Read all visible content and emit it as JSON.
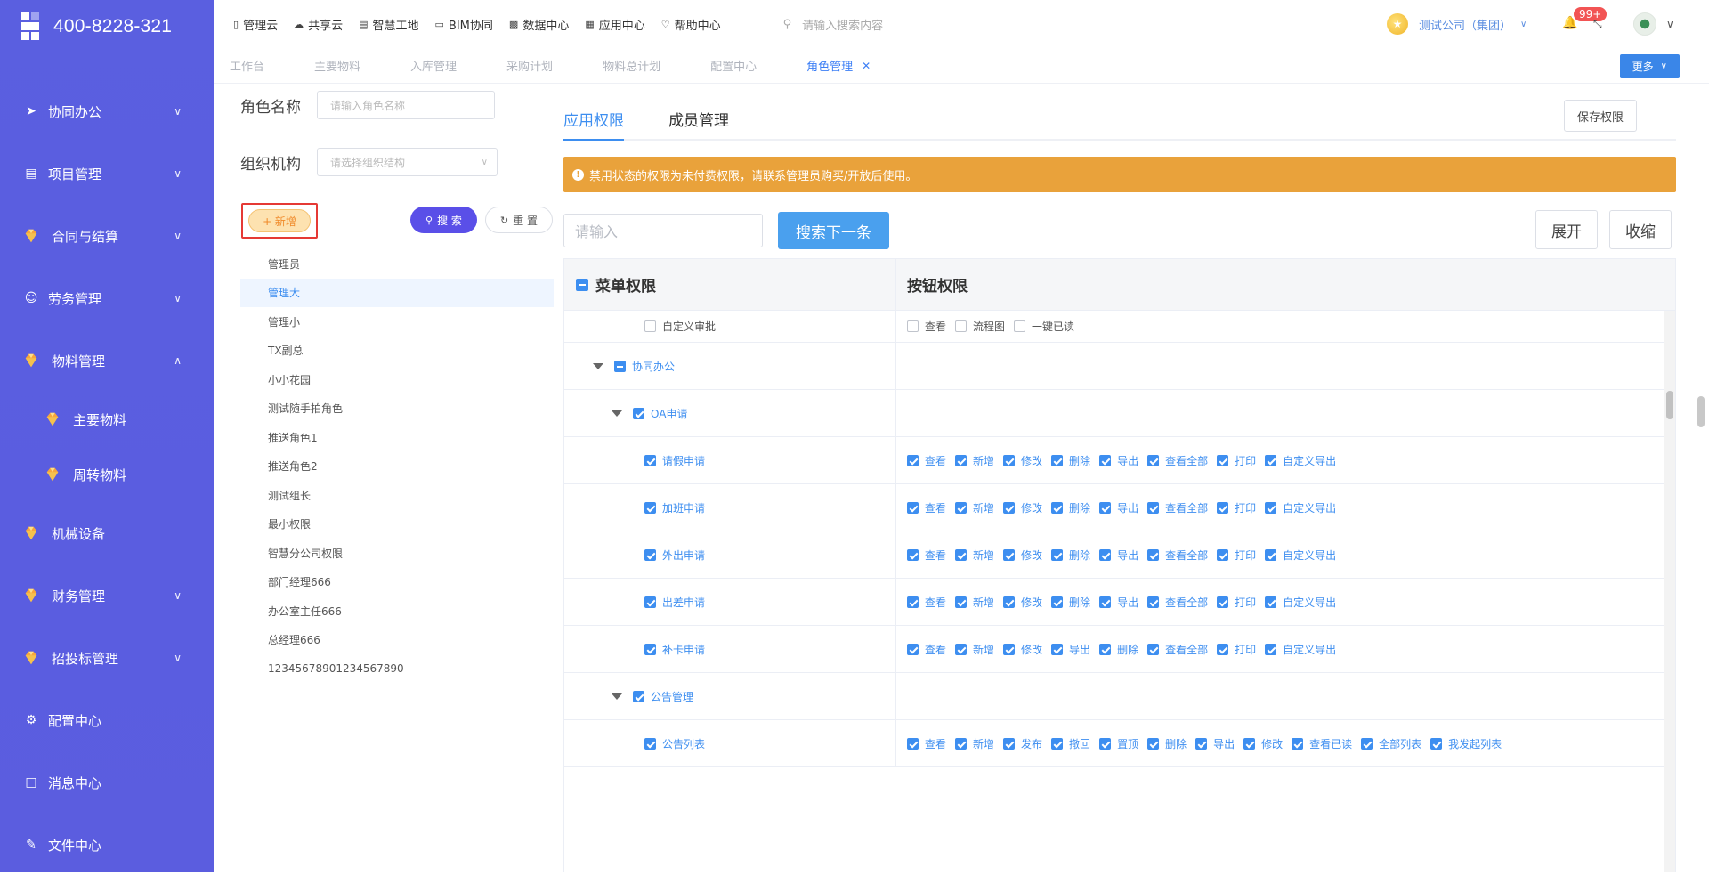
{
  "brand": {
    "phone": "400-8228-321"
  },
  "sidebar": {
    "items": [
      {
        "label": "协同办公",
        "icon": "send-icon",
        "expanded": false
      },
      {
        "label": "项目管理",
        "icon": "book-icon",
        "expanded": false
      },
      {
        "label": "合同与结算",
        "icon": "gem-icon",
        "expanded": false
      },
      {
        "label": "劳务管理",
        "icon": "user-icon",
        "expanded": false
      },
      {
        "label": "物料管理",
        "icon": "gem-icon",
        "expanded": true
      },
      {
        "label": "主要物料",
        "icon": "gem-icon",
        "sub": true
      },
      {
        "label": "周转物料",
        "icon": "gem-icon",
        "sub": true
      },
      {
        "label": "机械设备",
        "icon": "gem-icon"
      },
      {
        "label": "财务管理",
        "icon": "gem-icon",
        "expanded": false
      },
      {
        "label": "招投标管理",
        "icon": "gem-icon",
        "expanded": false
      },
      {
        "label": "配置中心",
        "icon": "gear-icon"
      },
      {
        "label": "消息中心",
        "icon": "message-icon"
      },
      {
        "label": "文件中心",
        "icon": "file-icon"
      }
    ]
  },
  "topbar": {
    "links": [
      "管理云",
      "共享云",
      "智慧工地",
      "BIM协同",
      "数据中心",
      "应用中心",
      "帮助中心"
    ],
    "search_placeholder": "请输入搜索内容",
    "company": "测试公司（集团）",
    "notif_count": "99+"
  },
  "tabs": {
    "items": [
      "工作台",
      "主要物料",
      "入库管理",
      "采购计划",
      "物料总计划",
      "配置中心"
    ],
    "active": "角色管理",
    "more": "更多"
  },
  "left": {
    "role_name_label": "角色名称",
    "role_name_placeholder": "请输入角色名称",
    "org_label": "组织机构",
    "org_placeholder": "请选择组织结构",
    "add_label": "+ 新增",
    "search_label": "搜 索",
    "reset_label": "重 置",
    "roles": [
      "管理员",
      "管理大",
      "管理小",
      "TX副总",
      "小小花园",
      "测试随手拍角色",
      "推送角色1",
      "推送角色2",
      "测试组长",
      "最小权限",
      "智慧分公司权限",
      "部门经理666",
      "办公室主任666",
      "总经理666",
      "12345678901234567890"
    ],
    "selected_role": "管理大"
  },
  "right": {
    "tab_app": "应用权限",
    "tab_members": "成员管理",
    "save_label": "保存权限",
    "alert": "禁用状态的权限为未付费权限，请联系管理员购买/开放后使用。",
    "keyword_placeholder": "请输入",
    "next_label": "搜索下一条",
    "expand_label": "展开",
    "collapse_label": "收缩",
    "col_menu": "菜单权限",
    "col_button": "按钮权限"
  },
  "table": {
    "rows": [
      {
        "menu": "自定义审批",
        "level": 2,
        "checked": false,
        "caret": false,
        "buttons": [
          {
            "label": "查看",
            "on": false
          },
          {
            "label": "流程图",
            "on": false
          },
          {
            "label": "一键已读",
            "on": false
          }
        ]
      },
      {
        "menu": "协同办公",
        "level": 0,
        "state": "half",
        "caret": true,
        "buttons": []
      },
      {
        "menu": "OA申请",
        "level": 1,
        "checked": true,
        "caret": true,
        "buttons": []
      },
      {
        "menu": "请假申请",
        "level": 2,
        "checked": true,
        "buttons": [
          {
            "label": "查看",
            "on": true
          },
          {
            "label": "新增",
            "on": true
          },
          {
            "label": "修改",
            "on": true
          },
          {
            "label": "删除",
            "on": true
          },
          {
            "label": "导出",
            "on": true
          },
          {
            "label": "查看全部",
            "on": true
          },
          {
            "label": "打印",
            "on": true
          },
          {
            "label": "自定义导出",
            "on": true
          }
        ]
      },
      {
        "menu": "加班申请",
        "level": 2,
        "checked": true,
        "buttons": [
          {
            "label": "查看",
            "on": true
          },
          {
            "label": "新增",
            "on": true
          },
          {
            "label": "修改",
            "on": true
          },
          {
            "label": "删除",
            "on": true
          },
          {
            "label": "导出",
            "on": true
          },
          {
            "label": "查看全部",
            "on": true
          },
          {
            "label": "打印",
            "on": true
          },
          {
            "label": "自定义导出",
            "on": true
          }
        ]
      },
      {
        "menu": "外出申请",
        "level": 2,
        "checked": true,
        "buttons": [
          {
            "label": "查看",
            "on": true
          },
          {
            "label": "新增",
            "on": true
          },
          {
            "label": "修改",
            "on": true
          },
          {
            "label": "删除",
            "on": true
          },
          {
            "label": "导出",
            "on": true
          },
          {
            "label": "查看全部",
            "on": true
          },
          {
            "label": "打印",
            "on": true
          },
          {
            "label": "自定义导出",
            "on": true
          }
        ]
      },
      {
        "menu": "出差申请",
        "level": 2,
        "checked": true,
        "buttons": [
          {
            "label": "查看",
            "on": true
          },
          {
            "label": "新增",
            "on": true
          },
          {
            "label": "修改",
            "on": true
          },
          {
            "label": "删除",
            "on": true
          },
          {
            "label": "导出",
            "on": true
          },
          {
            "label": "查看全部",
            "on": true
          },
          {
            "label": "打印",
            "on": true
          },
          {
            "label": "自定义导出",
            "on": true
          }
        ]
      },
      {
        "menu": "补卡申请",
        "level": 2,
        "checked": true,
        "buttons": [
          {
            "label": "查看",
            "on": true
          },
          {
            "label": "新增",
            "on": true
          },
          {
            "label": "修改",
            "on": true
          },
          {
            "label": "导出",
            "on": true
          },
          {
            "label": "删除",
            "on": true
          },
          {
            "label": "查看全部",
            "on": true
          },
          {
            "label": "打印",
            "on": true
          },
          {
            "label": "自定义导出",
            "on": true
          }
        ]
      },
      {
        "menu": "公告管理",
        "level": 1,
        "checked": true,
        "caret": true,
        "buttons": []
      },
      {
        "menu": "公告列表",
        "level": 2,
        "checked": true,
        "buttons": [
          {
            "label": "查看",
            "on": true
          },
          {
            "label": "新增",
            "on": true
          },
          {
            "label": "发布",
            "on": true
          },
          {
            "label": "撤回",
            "on": true
          },
          {
            "label": "置顶",
            "on": true
          },
          {
            "label": "删除",
            "on": true
          },
          {
            "label": "导出",
            "on": true
          },
          {
            "label": "修改",
            "on": true
          },
          {
            "label": "查看已读",
            "on": true
          },
          {
            "label": "全部列表",
            "on": true
          },
          {
            "label": "我发起列表",
            "on": true
          }
        ]
      }
    ]
  }
}
